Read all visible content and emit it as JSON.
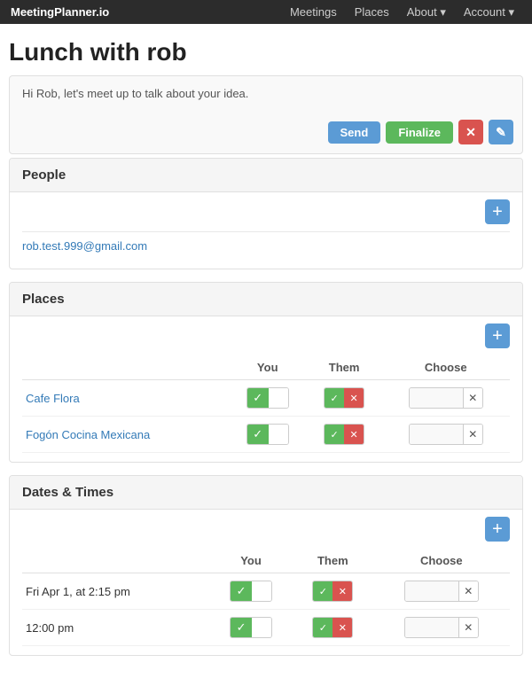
{
  "navbar": {
    "brand": "MeetingPlanner.io",
    "links": [
      {
        "label": "Meetings",
        "dropdown": false
      },
      {
        "label": "Places",
        "dropdown": false
      },
      {
        "label": "About",
        "dropdown": true
      },
      {
        "label": "Account",
        "dropdown": true
      }
    ]
  },
  "page": {
    "title": "Lunch with rob",
    "message": "Hi Rob, let's meet up to talk about your idea.",
    "send_label": "Send",
    "finalize_label": "Finalize"
  },
  "people": {
    "section_label": "People",
    "add_label": "+",
    "emails": [
      {
        "value": "rob.test.999@gmail.com"
      }
    ]
  },
  "places": {
    "section_label": "Places",
    "add_label": "+",
    "columns": [
      "",
      "You",
      "Them",
      "Choose"
    ],
    "rows": [
      {
        "name": "Cafe Flora"
      },
      {
        "name": "Fogón Cocina Mexicana"
      }
    ]
  },
  "dates": {
    "section_label": "Dates & Times",
    "add_label": "+",
    "columns": [
      "",
      "You",
      "Them",
      "Choose"
    ],
    "rows": [
      {
        "name": "Fri Apr 1, at 2:15 pm"
      },
      {
        "name": "12:00 pm"
      }
    ]
  },
  "icons": {
    "check": "✓",
    "cross": "✕",
    "pencil": "✎",
    "plus": "+"
  }
}
